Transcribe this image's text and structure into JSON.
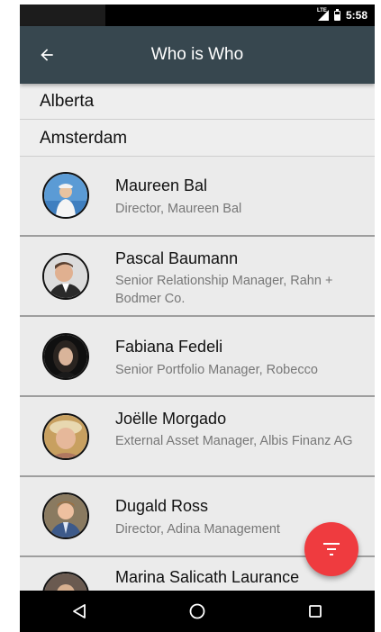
{
  "status_bar": {
    "network": "LTE",
    "time": "5:58"
  },
  "app_bar": {
    "title": "Who is Who",
    "back_icon": "arrow-back-icon"
  },
  "sections": [
    {
      "label": "Alberta"
    },
    {
      "label": "Amsterdam"
    }
  ],
  "people": [
    {
      "name": "Maureen Bal",
      "role": "Director, Maureen Bal"
    },
    {
      "name": "Pascal Baumann",
      "role": "Senior Relationship Manager, Rahn + Bodmer Co."
    },
    {
      "name": "Fabiana Fedeli",
      "role": "Senior Portfolio Manager, Robecco"
    },
    {
      "name": "Joëlle Morgado",
      "role": "External Asset Manager, Albis Finanz AG"
    },
    {
      "name": "Dugald Ross",
      "role": "Director, Adina Management"
    },
    {
      "name": "Marina Salicath Laurance",
      "role": ""
    }
  ],
  "fab": {
    "icon": "filter-icon",
    "color": "#ef3b3f"
  },
  "nav_bar": {
    "back_icon": "nav-back-icon",
    "home_icon": "nav-home-icon",
    "recents_icon": "nav-recents-icon"
  },
  "colors": {
    "app_bar": "#37474f",
    "list_background": "#ebebeb",
    "fab": "#ef3b3f"
  }
}
